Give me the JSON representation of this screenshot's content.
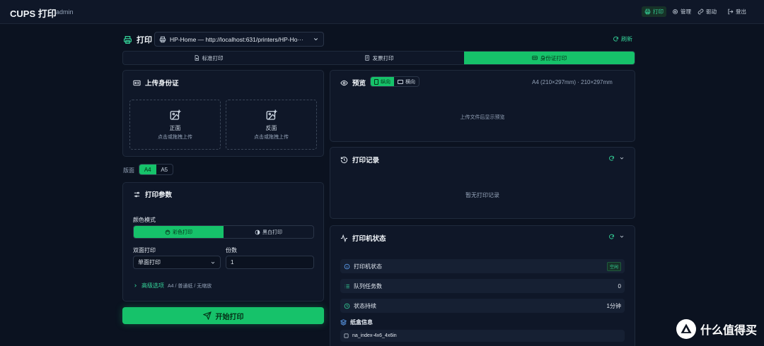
{
  "app": {
    "title": "CUPS 打印",
    "user": "admin"
  },
  "nav": [
    {
      "label": "打印",
      "icon": "printer-icon",
      "active": true
    },
    {
      "label": "管理",
      "icon": "gear-icon",
      "active": false
    },
    {
      "label": "驱动",
      "icon": "link-icon",
      "active": false
    },
    {
      "label": "登出",
      "icon": "logout-icon",
      "active": false
    }
  ],
  "header": {
    "title": "打印",
    "printer": "HP-Home — http://localhost:631/printers/HP-Ho···",
    "refresh": "刷新"
  },
  "tabs": [
    {
      "label": "标准打印",
      "icon": "document-icon",
      "active": false
    },
    {
      "label": "发票打印",
      "icon": "receipt-icon",
      "active": false
    },
    {
      "label": "身份证打印",
      "icon": "id-card-icon",
      "active": true
    }
  ],
  "upload": {
    "title": "上传身份证",
    "front": {
      "label": "正面",
      "hint": "点击或拖拽上传"
    },
    "back": {
      "label": "反面",
      "hint": "点击或拖拽上传"
    }
  },
  "paper": {
    "label": "版面",
    "options": [
      "A4",
      "A5"
    ],
    "selected": "A4"
  },
  "params": {
    "title": "打印参数",
    "color_mode_label": "颜色模式",
    "color_options": [
      "彩色打印",
      "黑白打印"
    ],
    "duplex_label": "双面打印",
    "duplex_value": "单面打印",
    "copies_label": "份数",
    "copies_value": "1",
    "advanced_label": "高级选项",
    "advanced_summary": "A4 / 普通纸 / 无缩放"
  },
  "start_button": "开始打印",
  "preview": {
    "title": "预览",
    "orientations": [
      "纵向",
      "横向"
    ],
    "paper_info": "A4 (210×297mm) · 210×297mm",
    "empty": "上传文件后显示预览"
  },
  "history": {
    "title": "打印记录",
    "empty": "暂无打印记录"
  },
  "status": {
    "title": "打印机状态",
    "rows": [
      {
        "label": "打印机状态",
        "value": "空闲",
        "icon": "info-icon"
      },
      {
        "label": "队列任务数",
        "value": "0",
        "icon": "list-icon"
      },
      {
        "label": "状态持续",
        "value": "1分钟",
        "icon": "clock-icon"
      }
    ],
    "tray_title": "纸盒信息",
    "tray_item": "na_index-4x6_4x6in"
  },
  "watermark": "什么值得买",
  "colors": {
    "accent": "#16c26a",
    "bg": "#0b1220",
    "panel": "#0f1728"
  }
}
